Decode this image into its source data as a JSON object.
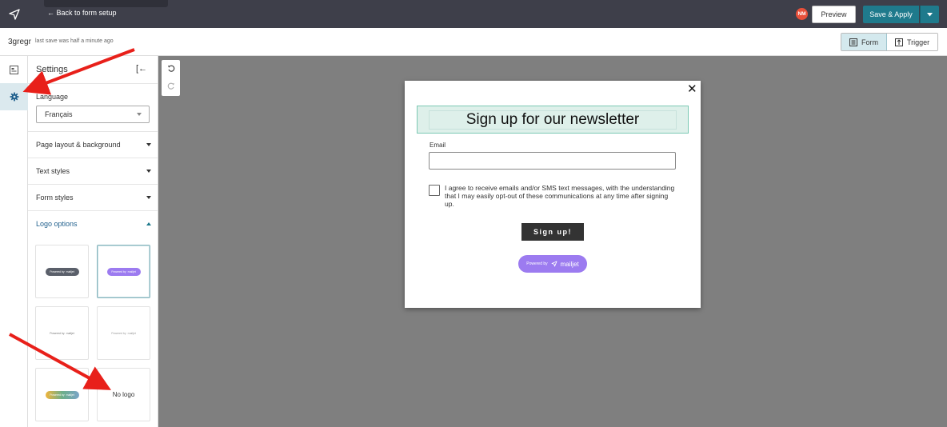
{
  "topbar": {
    "back_label": "← Back to form setup",
    "avatar_initials": "NM",
    "preview_label": "Preview",
    "save_label": "Save & Apply"
  },
  "subbar": {
    "form_name": "3gregr",
    "save_status": "last save was half a minute ago",
    "toggle_form": "Form",
    "toggle_trigger": "Trigger"
  },
  "settings": {
    "title": "Settings",
    "collapse_icon": "[←",
    "language_label": "Language",
    "language_value": "Français",
    "sections": [
      {
        "label": "Page layout & background",
        "open": false
      },
      {
        "label": "Text styles",
        "open": false
      },
      {
        "label": "Form styles",
        "open": false
      },
      {
        "label": "Logo options",
        "open": true
      }
    ],
    "logo_options": {
      "powered_by": "Powered by",
      "brand": "mailjet",
      "no_logo": "No logo"
    }
  },
  "modal": {
    "close_icon": "✕",
    "title": "Sign up for our newsletter",
    "email_label": "Email",
    "consent_text": "I agree to receive emails and/or SMS text messages, with the understanding that I may easily opt-out of these communications at any time after signing up.",
    "submit_label": "Sign up!",
    "powered_by": "Powered by",
    "brand": "mailjet"
  },
  "colors": {
    "topbar": "#3e3f4a",
    "accent": "#1f7a8c",
    "canvas": "#7f7f7f",
    "logo_purple": "#9c7bf0",
    "annotation_arrow": "#e8201a"
  }
}
